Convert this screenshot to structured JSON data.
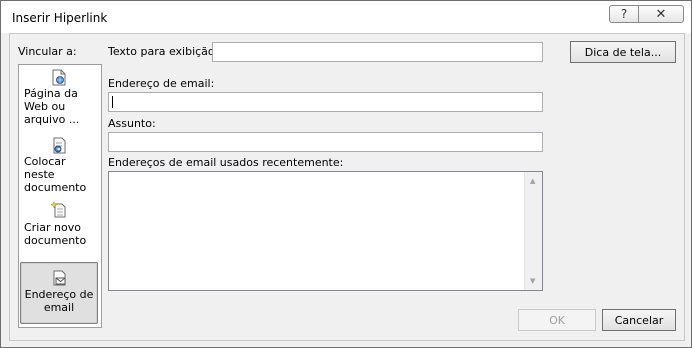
{
  "window": {
    "title": "Inserir Hiperlink"
  },
  "titlebar": {
    "help_label": "?",
    "close_label": "✕"
  },
  "sidebar": {
    "heading": "Vincular a:",
    "items": [
      {
        "label": "Página da Web ou arquivo ...",
        "icon": "web-page-icon",
        "selected": false
      },
      {
        "label": "Colocar neste documento",
        "icon": "place-in-document-icon",
        "selected": false
      },
      {
        "label": "Criar novo documento",
        "icon": "new-document-icon",
        "selected": false
      },
      {
        "label": "Endereço de email",
        "icon": "email-address-icon",
        "selected": true
      }
    ]
  },
  "display_text": {
    "label": "Texto para exibição:",
    "value": ""
  },
  "screentip_button": {
    "label": "Dica de tela..."
  },
  "email_address": {
    "label": "Endereço de email:",
    "value": ""
  },
  "subject": {
    "label": "Assunto:",
    "value": ""
  },
  "recent_emails": {
    "label": "Endereços de email usados recentemente:",
    "items": []
  },
  "buttons": {
    "ok": "OK",
    "cancel": "Cancelar"
  }
}
